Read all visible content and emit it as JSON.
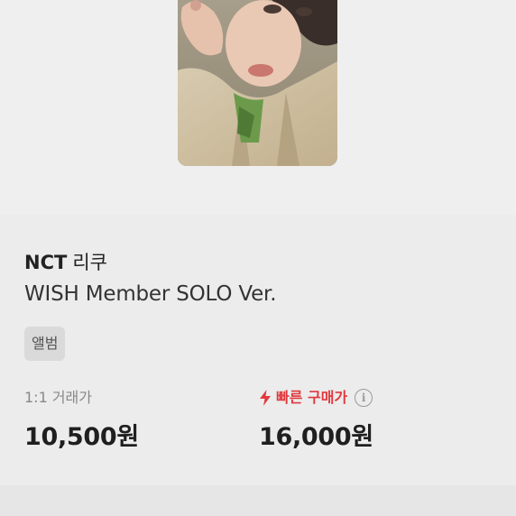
{
  "product": {
    "image_alt": "",
    "artist_en": "NCT",
    "artist_kr": "리쿠",
    "title": "WISH Member SOLO Ver.",
    "tag": "앨범"
  },
  "prices": {
    "trade_label": "1:1 거래가",
    "trade_value": "10,500원",
    "fast_label": "빠른 구매가",
    "fast_value": "16,000원",
    "info_glyph": "i"
  },
  "colors": {
    "accent_red": "#e0393e",
    "background": "#efefef",
    "tag_bg": "#dadada"
  },
  "icons": {
    "bolt": "lightning-bolt-icon",
    "info": "info-circle-icon"
  }
}
